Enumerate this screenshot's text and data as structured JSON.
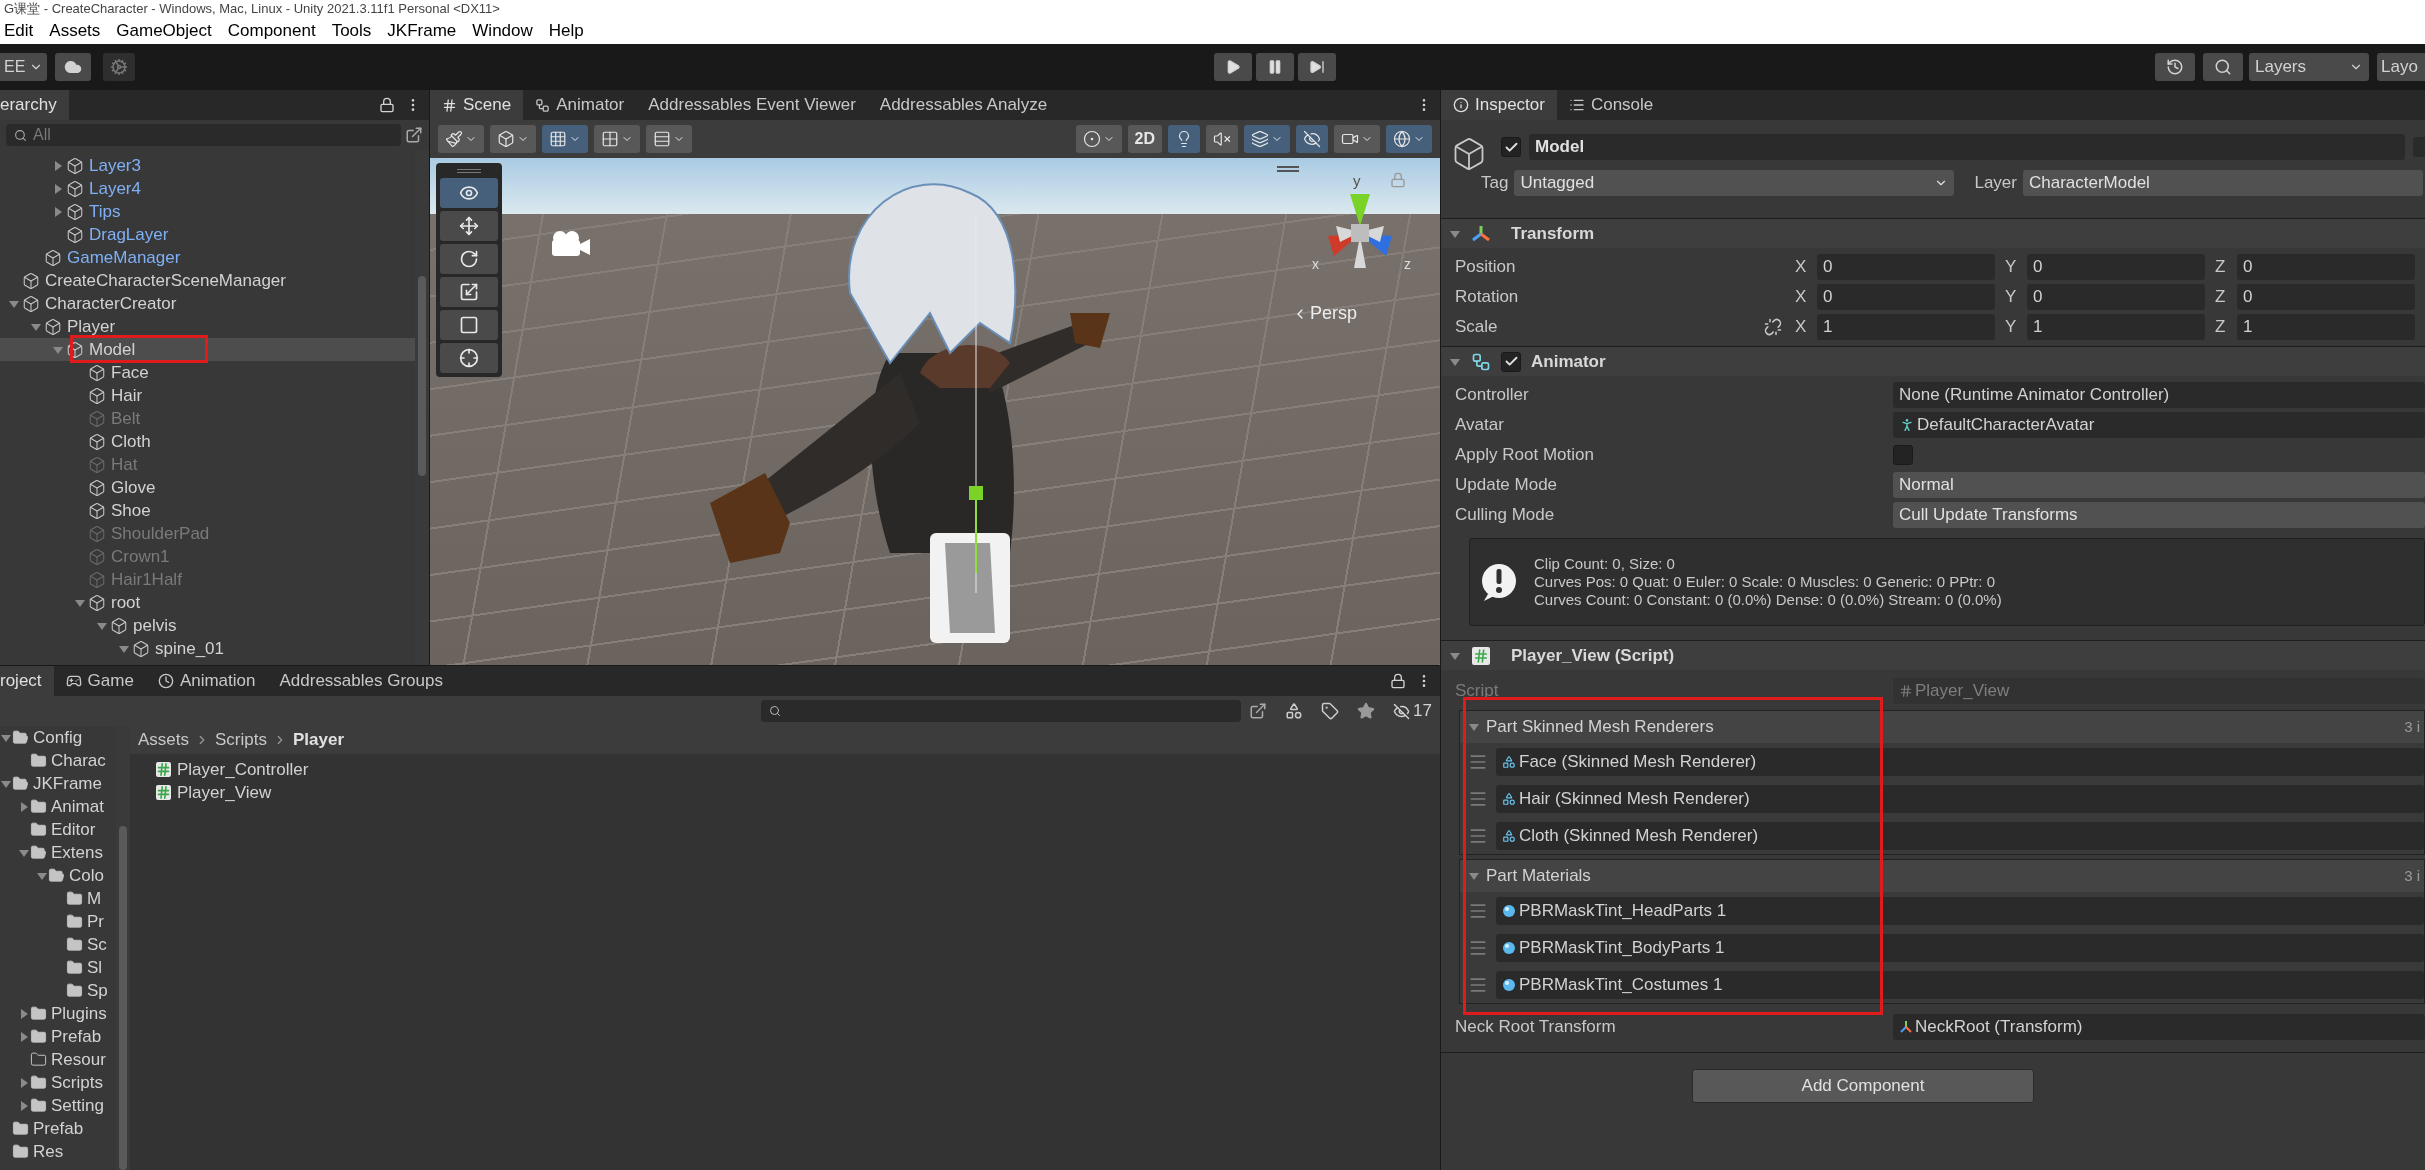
{
  "window": {
    "title": "G课堂 - CreateCharacter - Windows, Mac, Linux - Unity 2021.3.11f1 Personal <DX11>"
  },
  "menu": [
    "Edit",
    "Assets",
    "GameObject",
    "Component",
    "Tools",
    "JKFrame",
    "Window",
    "Help"
  ],
  "toolbar": {
    "account": "EE",
    "layers": "Layers",
    "layout": "Layo"
  },
  "hierarchy": {
    "tabs": [
      {
        "label": "erarchy",
        "selected": true
      }
    ],
    "search_placeholder": "All",
    "items": [
      {
        "children": [
          {
            "children": [
              {
                "name": "Layer3",
                "kind": "prefab",
                "active": true,
                "expanded": false,
                "selected": false
              },
              {
                "name": "Layer4",
                "kind": "prefab",
                "active": true,
                "expanded": false,
                "selected": false
              },
              {
                "name": "Tips",
                "kind": "prefab",
                "active": true,
                "expanded": false,
                "selected": false
              },
              {
                "name": "DragLayer",
                "kind": "prefab",
                "active": true,
                "selected": false
              }
            ]
          },
          {
            "name": "GameManager",
            "kind": "prefab",
            "active": true,
            "selected": false
          }
        ]
      },
      {
        "name": "CreateCharacterSceneManager",
        "kind": "object",
        "active": true,
        "selected": false
      },
      {
        "name": "CharacterCreator",
        "kind": "object",
        "active": true,
        "expanded": true,
        "selected": false,
        "children": [
          {
            "name": "Player",
            "kind": "object",
            "active": true,
            "expanded": true,
            "selected": false,
            "children": [
              {
                "name": "Model",
                "kind": "object",
                "active": true,
                "expanded": true,
                "selected": true,
                "children": [
                  {
                    "name": "Face",
                    "kind": "object",
                    "active": true,
                    "selected": false
                  },
                  {
                    "name": "Hair",
                    "kind": "object",
                    "active": true,
                    "selected": false
                  },
                  {
                    "name": "Belt",
                    "kind": "object",
                    "active": false,
                    "selected": false
                  },
                  {
                    "name": "Cloth",
                    "kind": "object",
                    "active": true,
                    "selected": false
                  },
                  {
                    "name": "Hat",
                    "kind": "object",
                    "active": false,
                    "selected": false
                  },
                  {
                    "name": "Glove",
                    "kind": "object",
                    "active": true,
                    "selected": false
                  },
                  {
                    "name": "Shoe",
                    "kind": "object",
                    "active": true,
                    "selected": false
                  },
                  {
                    "name": "ShoulderPad",
                    "kind": "object",
                    "active": false,
                    "selected": false
                  },
                  {
                    "name": "Crown1",
                    "kind": "object",
                    "active": false,
                    "selected": false
                  },
                  {
                    "name": "Hair1Half",
                    "kind": "object",
                    "active": false,
                    "selected": false
                  },
                  {
                    "name": "root",
                    "kind": "object",
                    "active": true,
                    "expanded": true,
                    "selected": false,
                    "children": [
                      {
                        "name": "pelvis",
                        "kind": "object",
                        "active": true,
                        "expanded": true,
                        "selected": false,
                        "children": [
                          {
                            "name": "spine_01",
                            "kind": "object",
                            "active": true,
                            "expanded": true,
                            "selected": false
                          }
                        ]
                      }
                    ]
                  }
                ]
              }
            ]
          }
        ]
      }
    ]
  },
  "scene": {
    "tabs": [
      {
        "label": "Scene",
        "selected": true
      },
      {
        "label": "Animator",
        "selected": false
      },
      {
        "label": "Addressables Event Viewer",
        "selected": false
      },
      {
        "label": "Addressables Analyze",
        "selected": false
      }
    ],
    "toolbar_left": [
      {
        "on": false
      },
      {
        "on": false
      },
      {
        "on": true
      },
      {
        "on": false
      },
      {
        "on": false
      }
    ],
    "toolbar_right": [
      {
        "on": false
      },
      {
        "label": "2D",
        "on": false
      },
      {
        "on": true
      },
      {
        "on": false
      },
      {
        "on": true
      },
      {
        "on": true
      },
      {
        "on": false
      },
      {
        "on": true
      }
    ],
    "tools": [
      {
        "selected": true
      },
      {
        "selected": false
      },
      {
        "selected": false
      },
      {
        "selected": false
      },
      {
        "selected": false
      },
      {
        "selected": false
      }
    ],
    "axes": [
      "x",
      "y",
      "z"
    ],
    "projection": "Persp"
  },
  "project": {
    "tabs": [
      {
        "label": "roject",
        "selected": true
      },
      {
        "label": "Game",
        "selected": false
      },
      {
        "label": "Animation",
        "selected": false
      },
      {
        "label": "Addressables Groups",
        "selected": false
      }
    ],
    "hidden_count": "17",
    "folders": [
      {
        "name": "Config",
        "expanded": true,
        "children": [
          {
            "name": "Charac"
          }
        ]
      },
      {
        "name": "JKFrame",
        "expanded": true,
        "children": [
          {
            "name": "Animat",
            "expanded": false
          },
          {
            "name": "Editor"
          },
          {
            "name": "Extens",
            "expanded": true,
            "children": [
              {
                "name": "Colo",
                "expanded": true,
                "children": [
                  {
                    "name": "M"
                  },
                  {
                    "name": "Pr"
                  },
                  {
                    "name": "Sc"
                  },
                  {
                    "name": "Sl"
                  },
                  {
                    "name": "Sp"
                  }
                ]
              }
            ]
          },
          {
            "name": "Plugins",
            "expanded": false
          },
          {
            "name": "Prefab",
            "expanded": false
          },
          {
            "name": "Resour",
            "empty": true
          },
          {
            "name": "Scripts",
            "expanded": false
          },
          {
            "name": "Setting",
            "expanded": false
          }
        ]
      },
      {
        "name": "Prefab"
      },
      {
        "name": "Res"
      }
    ],
    "breadcrumb": [
      "Assets",
      "Scripts",
      "Player"
    ],
    "files": [
      "Player_Controller",
      "Player_View"
    ]
  },
  "inspector": {
    "tabs": [
      {
        "label": "Inspector",
        "selected": true
      },
      {
        "label": "Console",
        "selected": false
      }
    ],
    "object": {
      "active": true,
      "name": "Model",
      "static": false,
      "tag_label": "Tag",
      "tag": "Untagged",
      "layer_label": "Layer",
      "layer": "CharacterModel"
    },
    "components": [
      {
        "kind": "transform",
        "title": "Transform",
        "rows": [
          {
            "label": "Position",
            "axes": [
              "X",
              "Y",
              "Z"
            ],
            "values": [
              "0",
              "0",
              "0"
            ]
          },
          {
            "label": "Rotation",
            "axes": [
              "X",
              "Y",
              "Z"
            ],
            "values": [
              "0",
              "0",
              "0"
            ]
          },
          {
            "label": "Scale",
            "axes": [
              "X",
              "Y",
              "Z"
            ],
            "values": [
              "1",
              "1",
              "1"
            ]
          }
        ]
      },
      {
        "kind": "animator",
        "title": "Animator",
        "enabled": true,
        "properties": [
          {
            "label": "Controller",
            "kind": "object",
            "value": "None (Runtime Animator Controller)"
          },
          {
            "label": "Avatar",
            "kind": "avatar",
            "value": "DefaultCharacterAvatar"
          },
          {
            "label": "Apply Root Motion",
            "kind": "checkbox",
            "checked": false
          },
          {
            "label": "Update Mode",
            "kind": "dropdown",
            "value": "Normal"
          },
          {
            "label": "Culling Mode",
            "kind": "dropdown",
            "value": "Cull Update Transforms"
          }
        ],
        "info": [
          "Clip Count: 0, Size: 0",
          "Curves Pos: 0 Quat: 0 Euler: 0 Scale: 0 Muscles: 0 Generic: 0 PPtr: 0",
          "Curves Count: 0 Constant: 0 (0.0%) Dense: 0 (0.0%) Stream: 0 (0.0%)"
        ]
      },
      {
        "kind": "script",
        "title": "Player_View (Script)",
        "script_label": "Script",
        "script": "Player_View",
        "lists": [
          {
            "title": "Part Skinned Mesh Renderers",
            "kind": "renderer",
            "count": "3 i",
            "expanded": true,
            "items": [
              "Face (Skinned Mesh Renderer)",
              "Hair (Skinned Mesh Renderer)",
              "Cloth (Skinned Mesh Renderer)"
            ]
          },
          {
            "title": "Part Materials",
            "kind": "material",
            "count": "3 i",
            "expanded": true,
            "items": [
              "PBRMaskTint_HeadParts 1",
              "PBRMaskTint_BodyParts 1",
              "PBRMaskTint_Costumes 1"
            ]
          }
        ],
        "properties": [
          {
            "label": "Neck Root Transform",
            "value": "NeckRoot (Transform)"
          }
        ]
      }
    ],
    "add_component": "Add Component"
  }
}
